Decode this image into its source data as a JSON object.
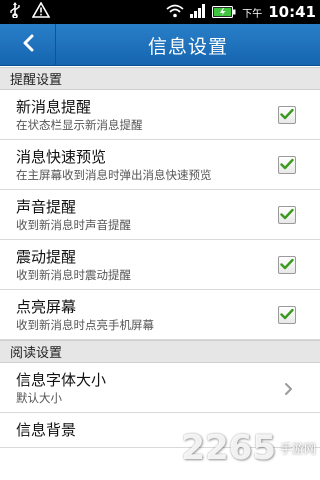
{
  "status_bar": {
    "ampm": "下午",
    "time": "10:41",
    "icons": [
      "usb-icon",
      "warning-icon",
      "wifi-icon",
      "signal-icon",
      "battery-icon"
    ]
  },
  "header": {
    "title": "信息设置",
    "back_icon": "chevron-left-icon",
    "background_color": "#1e73be"
  },
  "sections": {
    "reminder": {
      "label": "提醒设置",
      "items": [
        {
          "title": "新消息提醒",
          "subtitle": "在状态栏显示新消息提醒",
          "checked": true
        },
        {
          "title": "消息快速预览",
          "subtitle": "在主屏幕收到消息时弹出消息快速预览",
          "checked": true
        },
        {
          "title": "声音提醒",
          "subtitle": "收到新消息时声音提醒",
          "checked": true
        },
        {
          "title": "震动提醒",
          "subtitle": "收到新消息时震动提醒",
          "checked": true
        },
        {
          "title": "点亮屏幕",
          "subtitle": "收到新消息时点亮手机屏幕",
          "checked": true
        }
      ]
    },
    "reading": {
      "label": "阅读设置",
      "items": [
        {
          "title": "信息字体大小",
          "subtitle": "默认大小"
        },
        {
          "title": "信息背景",
          "subtitle": ""
        }
      ]
    }
  },
  "watermark": {
    "number": "2265",
    "text": "手游网"
  },
  "colors": {
    "check": "#3a9a1e",
    "section_bg": "#e6e6e6"
  }
}
